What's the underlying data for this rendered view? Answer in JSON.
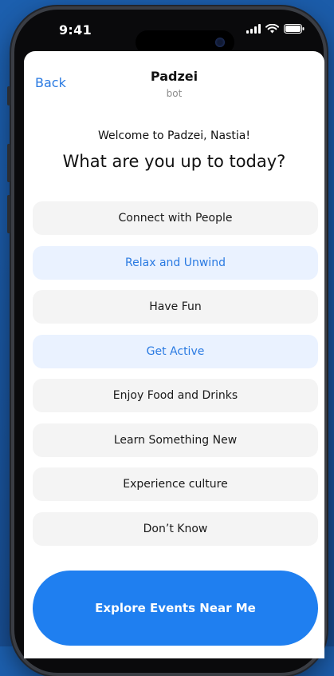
{
  "status_bar": {
    "time": "9:41",
    "icons": [
      "cellular-signal-icon",
      "wifi-icon",
      "battery-icon"
    ]
  },
  "nav": {
    "back_label": "Back",
    "title": "Padzei",
    "subtitle": "bot"
  },
  "welcome_text": "Welcome to Padzei, Nastia!",
  "headline": "What are you up to today?",
  "options": [
    {
      "label": "Connect with People",
      "selected": false
    },
    {
      "label": "Relax and Unwind",
      "selected": true
    },
    {
      "label": "Have Fun",
      "selected": false
    },
    {
      "label": "Get Active",
      "selected": true
    },
    {
      "label": "Enjoy Food and Drinks",
      "selected": false
    },
    {
      "label": "Learn Something New",
      "selected": false
    },
    {
      "label": "Experience culture",
      "selected": false
    },
    {
      "label": "Don’t Know",
      "selected": false
    }
  ],
  "cta_label": "Explore Events Near Me",
  "colors": {
    "accent": "#2a7ae2",
    "cta": "#1f7ff0",
    "selected_bg": "#eaf2ff",
    "option_bg": "#f4f4f4",
    "background": "#1c5fae"
  }
}
